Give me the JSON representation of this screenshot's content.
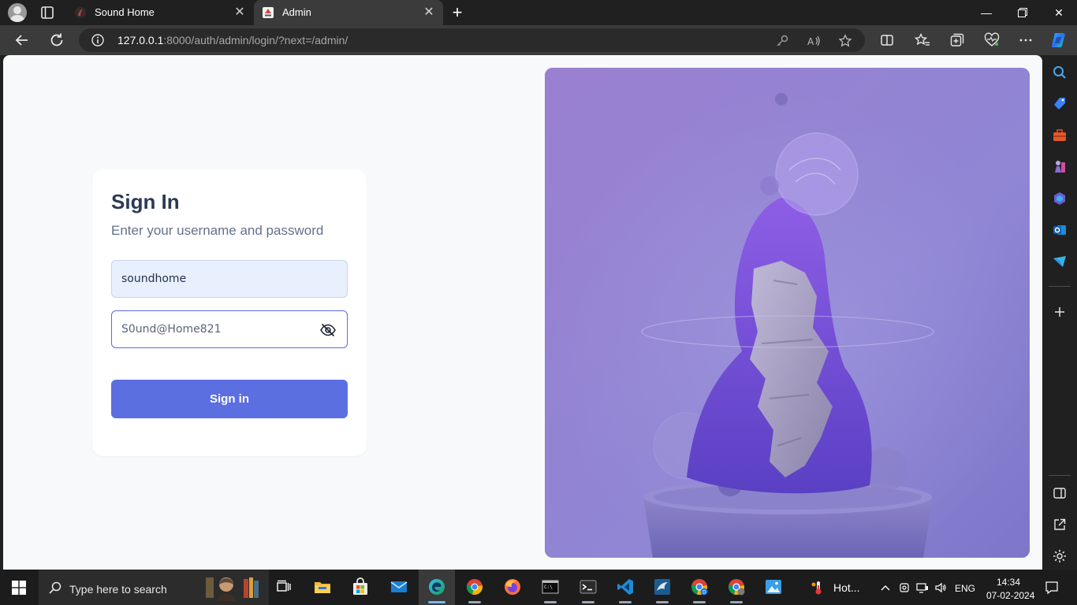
{
  "browser": {
    "tabs": [
      {
        "title": "Sound Home",
        "active": false
      },
      {
        "title": "Admin",
        "active": true
      }
    ],
    "address": {
      "host": "127.0.0.1",
      "rest": ":8000/auth/admin/login/?next=/admin/"
    }
  },
  "login": {
    "title": "Sign In",
    "subtitle": "Enter your username and password",
    "username_value": "soundhome",
    "password_value": "S0und@Home821",
    "submit_label": "Sign in",
    "accent_color": "#5b6fe1"
  },
  "taskbar": {
    "search_placeholder": "Type here to search",
    "weather_text": "Hot...",
    "language": "ENG",
    "time": "14:34",
    "date": "07-02-2024"
  }
}
